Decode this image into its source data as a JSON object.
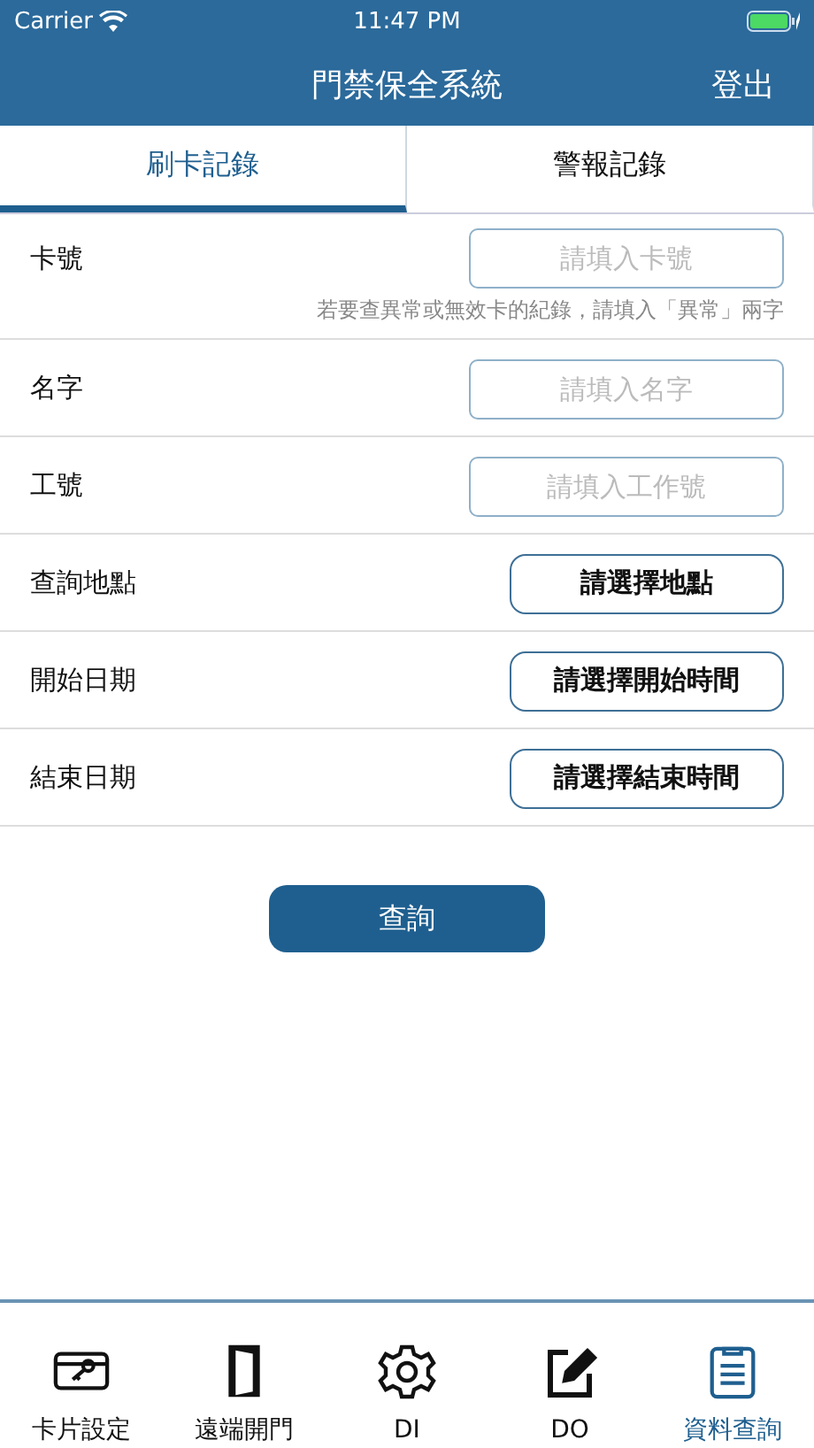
{
  "status_bar": {
    "carrier": "Carrier",
    "time": "11:47 PM"
  },
  "nav": {
    "title": "門禁保全系統",
    "action": "登出"
  },
  "tabs": [
    {
      "label": "刷卡記錄",
      "selected": true
    },
    {
      "label": "警報記錄",
      "selected": false
    }
  ],
  "form": [
    {
      "kind": "input",
      "label": "卡號",
      "placeholder": "請填入卡號",
      "hint": "若要查異常或無效卡的紀錄，請填入「異常」兩字"
    },
    {
      "kind": "input",
      "label": "名字",
      "placeholder": "請填入名字"
    },
    {
      "kind": "input",
      "label": "工號",
      "placeholder": "請填入工作號"
    },
    {
      "kind": "select",
      "label": "查詢地點",
      "button": "請選擇地點"
    },
    {
      "kind": "select",
      "label": "開始日期",
      "button": "請選擇開始時間"
    },
    {
      "kind": "select",
      "label": "結束日期",
      "button": "請選擇結束時間"
    }
  ],
  "submit": "查詢",
  "tab_bar": [
    {
      "label": "卡片設定",
      "selected": false
    },
    {
      "label": "遠端開門",
      "selected": false
    },
    {
      "label": "DI",
      "selected": false
    },
    {
      "label": "DO",
      "selected": false
    },
    {
      "label": "資料查詢",
      "selected": true
    }
  ]
}
